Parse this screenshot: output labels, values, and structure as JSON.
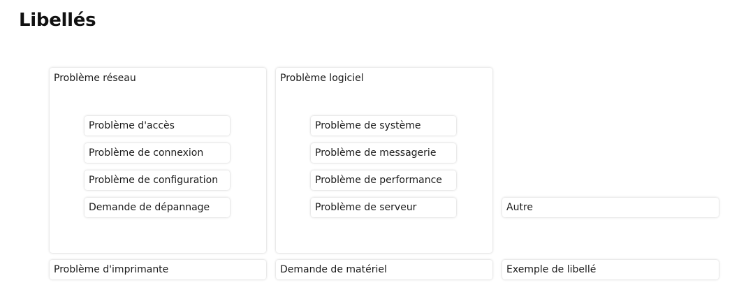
{
  "page": {
    "title": "Libellés"
  },
  "groups": [
    {
      "label": "Problème réseau",
      "items": [
        "Problème d'accès",
        "Problème de connexion",
        "Problème de configuration",
        "Demande de dépannage"
      ]
    },
    {
      "label": "Problème logiciel",
      "items": [
        "Problème de système",
        "Problème de messagerie",
        "Problème de performance",
        "Problème de serveur"
      ]
    }
  ],
  "singles": {
    "autre": "Autre",
    "imprimante": "Problème d'imprimante",
    "materiel": "Demande de matériel",
    "exemple": "Exemple de libellé"
  }
}
